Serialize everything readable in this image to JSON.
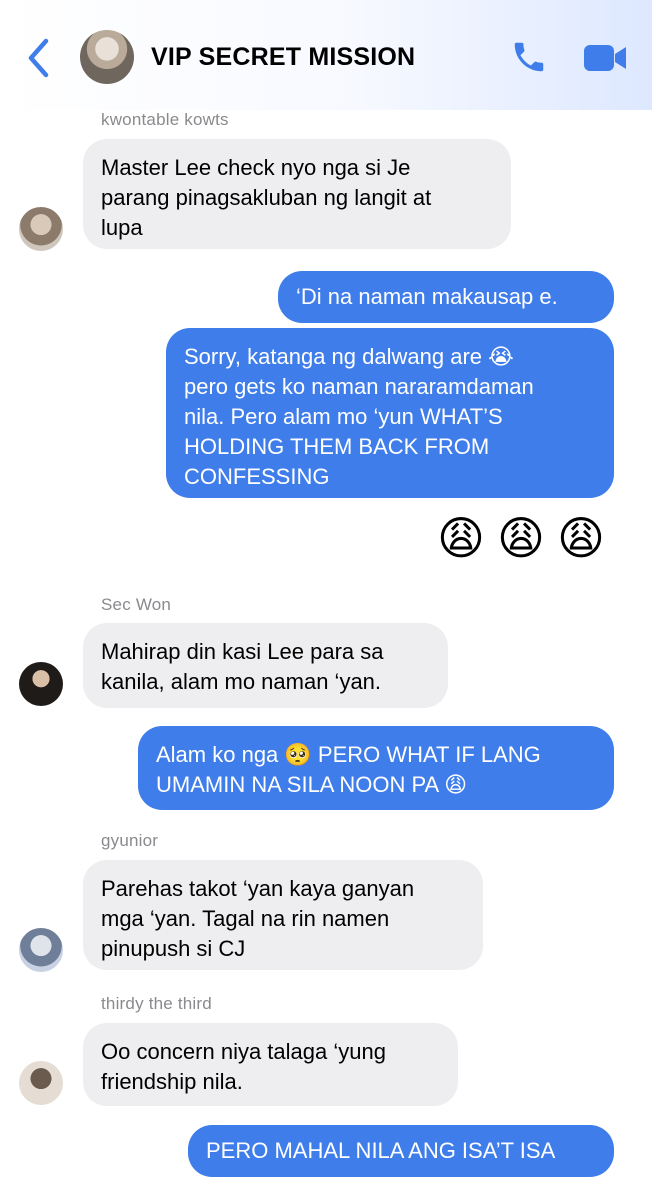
{
  "header": {
    "title": "VIP SECRET MISSION"
  },
  "messages": {
    "m1": {
      "sender": "kwontable kowts",
      "text": "Master Lee check nyo nga si Je\nparang pinagsakluban ng langit at\nlupa"
    },
    "m2": {
      "text": "‘Di na naman makausap e."
    },
    "m3": {
      "text": "Sorry, katanga ng dalwang are 😭\npero gets ko naman nararamdaman\nnila. Pero alam mo ‘yun WHAT’S\nHOLDING THEM BACK FROM\nCONFESSING"
    },
    "m4": {
      "emojis": "😩"
    },
    "m5": {
      "sender": "Sec Won",
      "text": "Mahirap din kasi Lee para sa\nkanila, alam mo naman ‘yan."
    },
    "m6": {
      "text": "Alam ko nga 🥺  PERO WHAT IF LANG\nUMAMIN NA SILA NOON PA 😩"
    },
    "m7": {
      "sender": "gyunior",
      "text": "Parehas takot ‘yan kaya ganyan\nmga ‘yan. Tagal na rin namen\npinupush si CJ"
    },
    "m8": {
      "sender": "thirdy the third",
      "text": "Oo concern niya talaga ‘yung\nfriendship nila."
    },
    "m9": {
      "text": "PERO MAHAL NILA ANG ISA’T ISA"
    }
  },
  "colors": {
    "accent": "#3f7dea",
    "incoming_bubble": "#eeeef0",
    "sender_gray": "#8a8a8e"
  },
  "icons": [
    "back-chevron-icon",
    "phone-icon",
    "video-camera-icon"
  ]
}
